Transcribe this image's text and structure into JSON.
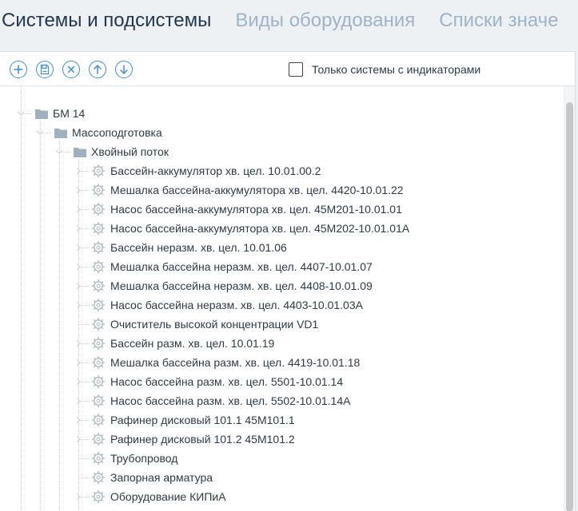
{
  "tabs": [
    {
      "label": "Системы и подсистемы"
    },
    {
      "label": "Виды оборудования"
    },
    {
      "label": "Списки значе"
    }
  ],
  "toolbar": {
    "checkbox_label": "Только системы с индикаторами"
  },
  "tree": {
    "root": {
      "label": "БМ 14"
    },
    "level1": {
      "label": "Массоподготовка"
    },
    "level2": {
      "label": "Хвойный поток"
    },
    "items": [
      {
        "label": "Бассейн-аккумулятор хв. цел. 10.01.00.2"
      },
      {
        "label": "Мешалка бассейна-аккумулятора хв. цел. 4420-10.01.22"
      },
      {
        "label": "Насос бассейна-аккумулятора хв. цел. 45М201-10.01.01"
      },
      {
        "label": "Насос бассейна-аккумулятора хв. цел. 45М202-10.01.01А"
      },
      {
        "label": " Бассейн неразм. хв. цел. 10.01.06"
      },
      {
        "label": "Мешалка бассейна неразм. хв. цел. 4407-10.01.07"
      },
      {
        "label": "Мешалка бассейна неразм. хв. цел. 4408-10.01.09"
      },
      {
        "label": "Насос бассейна неразм. хв. цел. 4403-10.01.03А"
      },
      {
        "label": "Очиститель высокой концентрации VD1"
      },
      {
        "label": "Бассейн разм. хв. цел. 10.01.19"
      },
      {
        "label": "Мешалка бассейна разм. хв. цел. 4419-10.01.18"
      },
      {
        "label": "Насос бассейна разм. хв. цел. 5501-10.01.14"
      },
      {
        "label": "Насос бассейна разм. хв. цел. 5502-10.01.14А"
      },
      {
        "label": "Рафинер дисковый 101.1 45М101.1"
      },
      {
        "label": "Рафинер дисковый 101.2 45М101.2"
      },
      {
        "label": "Трубопровод"
      },
      {
        "label": "Запорная арматура"
      },
      {
        "label": "Оборудование КИПиА"
      }
    ]
  }
}
